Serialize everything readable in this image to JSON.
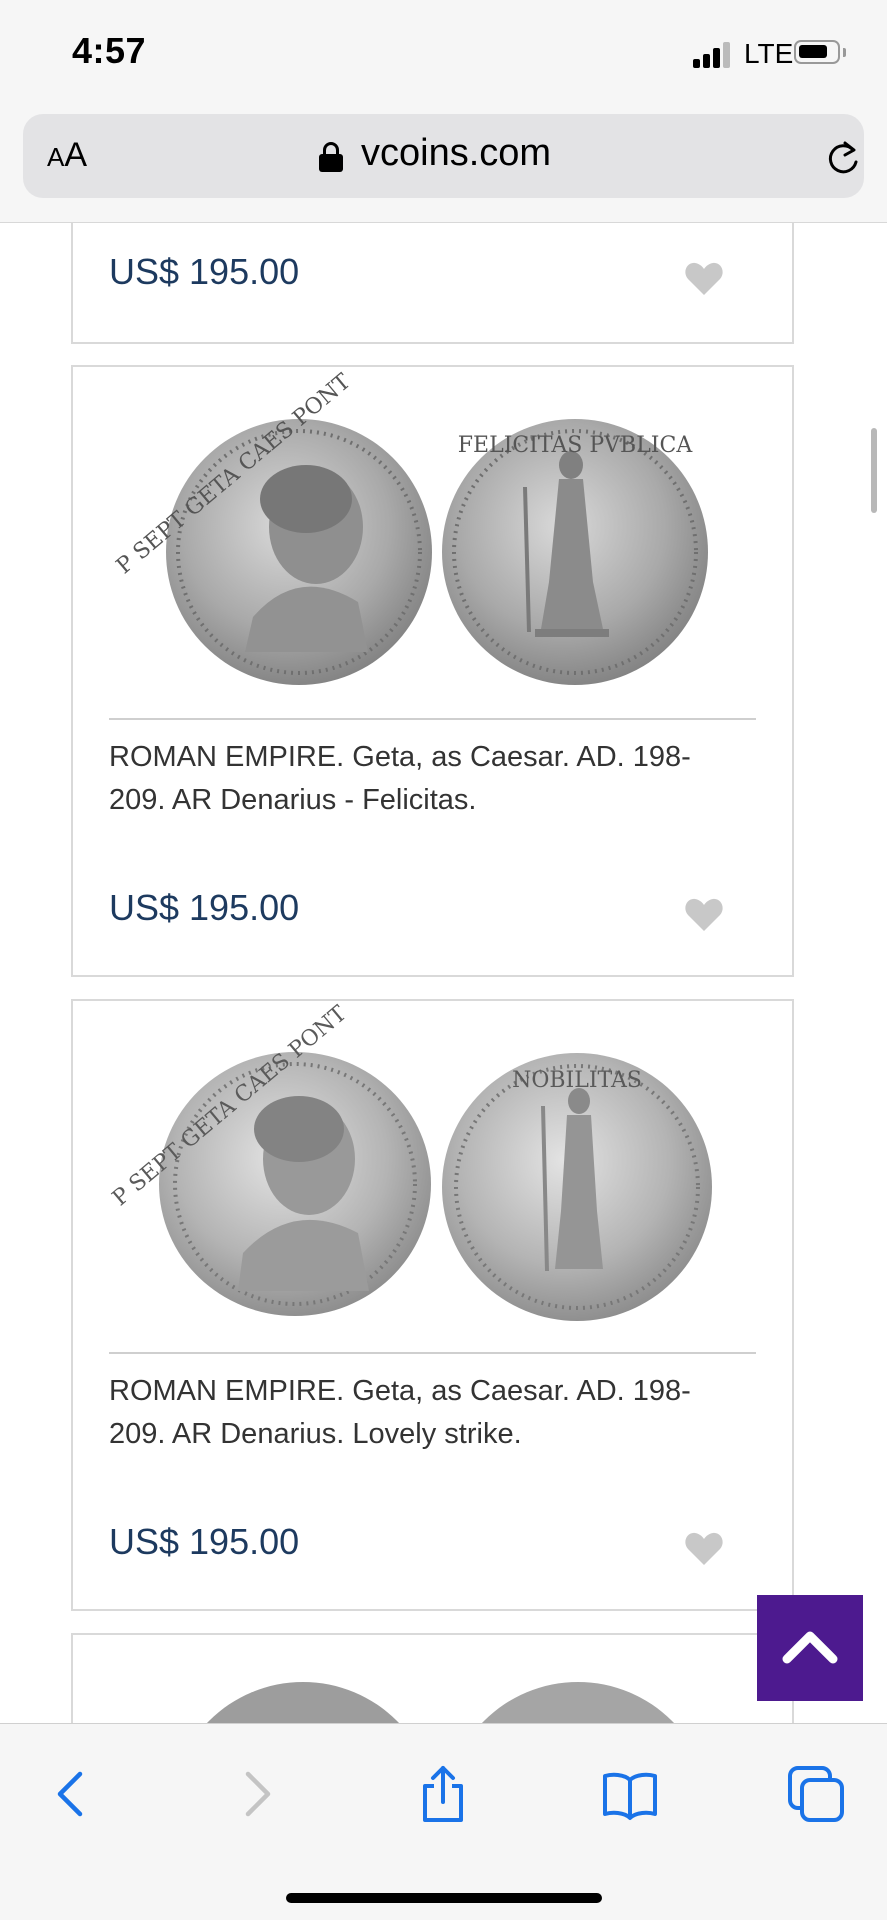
{
  "status_bar": {
    "time": "4:57",
    "network": "LTE",
    "icons": [
      "cellular-signal-icon",
      "battery-icon"
    ]
  },
  "url_bar": {
    "text_size_label_small": "A",
    "text_size_label_big": "A",
    "domain": "vcoins.com",
    "icons": [
      "lock-icon",
      "reload-icon"
    ]
  },
  "listings": [
    {
      "title": "",
      "price": "US$ 195.00"
    },
    {
      "title": "ROMAN EMPIRE. Geta, as Caesar. AD. 198-209. AR Denarius - Felicitas.",
      "price": "US$ 195.00",
      "coin_legends": {
        "obverse": "P SEPT GETA CAES PONT",
        "reverse": "FELICITAS PVBLICA"
      }
    },
    {
      "title": "ROMAN EMPIRE. Geta, as Caesar. AD. 198-209. AR Denarius. Lovely strike.",
      "price": "US$ 195.00",
      "coin_legends": {
        "obverse": "P SEPT GETA CAES PONT",
        "reverse": "NOBILITAS"
      }
    }
  ],
  "scroll_top": {
    "icon": "chevron-up-icon",
    "color": "#4d1a8f"
  },
  "toolbar": {
    "icons": [
      "back-icon",
      "forward-icon",
      "share-icon",
      "bookmarks-icon",
      "tabs-icon"
    ]
  },
  "colors": {
    "price": "#1d3a5f",
    "accent": "#4d1a8f",
    "ios_blue": "#1a73e8"
  }
}
